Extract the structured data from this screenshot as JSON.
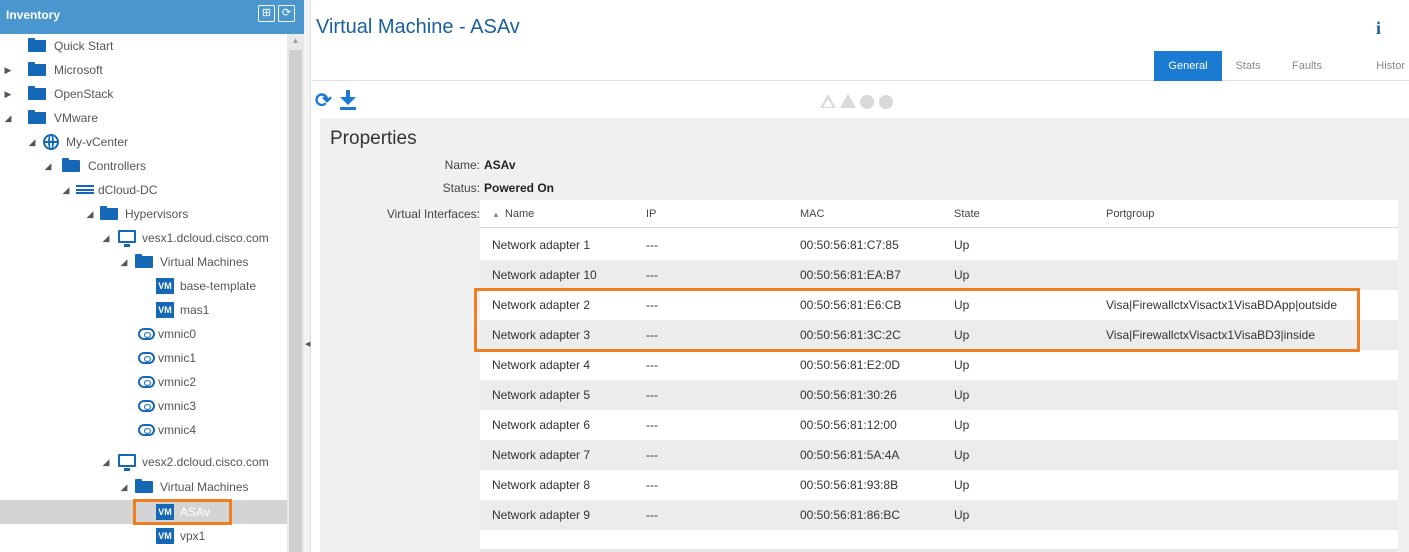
{
  "inventory": {
    "title": "Inventory",
    "tree": [
      {
        "label": "Quick Start",
        "icon": "folder-icon"
      },
      {
        "label": "Microsoft",
        "icon": "folder-icon",
        "expander": "collapsed"
      },
      {
        "label": "OpenStack",
        "icon": "folder-icon",
        "expander": "collapsed"
      },
      {
        "label": "VMware",
        "icon": "folder-icon",
        "expander": "expanded"
      },
      {
        "label": "My-vCenter",
        "icon": "globe-icon",
        "expander": "expanded"
      },
      {
        "label": "Controllers",
        "icon": "folder-icon",
        "expander": "expanded"
      },
      {
        "label": "dCloud-DC",
        "icon": "datacenter-icon",
        "expander": "expanded"
      },
      {
        "label": "Hypervisors",
        "icon": "folder-icon",
        "expander": "expanded"
      },
      {
        "label": "vesx1.dcloud.cisco.com",
        "icon": "host-icon",
        "expander": "expanded"
      },
      {
        "label": "Virtual Machines",
        "icon": "folder-icon",
        "expander": "expanded"
      },
      {
        "label": "base-template",
        "icon": "vm-icon",
        "icon_text": "VM"
      },
      {
        "label": "mas1",
        "icon": "vm-icon",
        "icon_text": "VM"
      },
      {
        "label": "vmnic0",
        "icon": "cloud-icon"
      },
      {
        "label": "vmnic1",
        "icon": "cloud-icon"
      },
      {
        "label": "vmnic2",
        "icon": "cloud-icon"
      },
      {
        "label": "vmnic3",
        "icon": "cloud-icon"
      },
      {
        "label": "vmnic4",
        "icon": "cloud-icon"
      },
      {
        "label": "vesx2.dcloud.cisco.com",
        "icon": "host-icon",
        "expander": "expanded"
      },
      {
        "label": "Virtual Machines",
        "icon": "folder-icon",
        "expander": "expanded"
      },
      {
        "label": "ASAv",
        "icon": "vm-icon",
        "icon_text": "VM",
        "selected": true
      },
      {
        "label": "vpx1",
        "icon": "vm-icon",
        "icon_text": "VM"
      }
    ]
  },
  "main": {
    "title": "Virtual Machine - ASAv",
    "info_glyph": "i",
    "tabs": [
      "General",
      "Stats",
      "Faults",
      "Histor"
    ],
    "active_tab": "General",
    "toolbar": {
      "refresh_glyph": "⟳"
    },
    "section_title": "Properties",
    "properties": {
      "name_label": "Name:",
      "name_value": "ASAv",
      "status_label": "Status:",
      "status_value": "Powered On",
      "interfaces_label": "Virtual Interfaces:"
    },
    "interfaces": {
      "columns": [
        "Name",
        "IP",
        "MAC",
        "State",
        "Portgroup"
      ],
      "sorted_column": "Name",
      "rows": [
        {
          "name": "Network adapter 1",
          "ip": "---",
          "mac": "00:50:56:81:C7:85",
          "state": "Up",
          "portgroup": ""
        },
        {
          "name": "Network adapter 10",
          "ip": "---",
          "mac": "00:50:56:81:EA:B7",
          "state": "Up",
          "portgroup": ""
        },
        {
          "name": "Network adapter 2",
          "ip": "---",
          "mac": "00:50:56:81:E6:CB",
          "state": "Up",
          "portgroup": "Visa|FirewallctxVisactx1VisaBDApp|outside"
        },
        {
          "name": "Network adapter 3",
          "ip": "---",
          "mac": "00:50:56:81:3C:2C",
          "state": "Up",
          "portgroup": "Visa|FirewallctxVisactx1VisaBD3|inside"
        },
        {
          "name": "Network adapter 4",
          "ip": "---",
          "mac": "00:50:56:81:E2:0D",
          "state": "Up",
          "portgroup": ""
        },
        {
          "name": "Network adapter 5",
          "ip": "---",
          "mac": "00:50:56:81:30:26",
          "state": "Up",
          "portgroup": ""
        },
        {
          "name": "Network adapter 6",
          "ip": "---",
          "mac": "00:50:56:81:12:00",
          "state": "Up",
          "portgroup": ""
        },
        {
          "name": "Network adapter 7",
          "ip": "---",
          "mac": "00:50:56:81:5A:4A",
          "state": "Up",
          "portgroup": ""
        },
        {
          "name": "Network adapter 8",
          "ip": "---",
          "mac": "00:50:56:81:93:8B",
          "state": "Up",
          "portgroup": ""
        },
        {
          "name": "Network adapter 9",
          "ip": "---",
          "mac": "00:50:56:81:86:BC",
          "state": "Up",
          "portgroup": ""
        }
      ]
    }
  },
  "colors": {
    "header_blue": "#4a97cf",
    "accent_blue": "#1b7ad1",
    "highlight_orange": "#ef7d22",
    "selected_row": "#d4d4d4"
  }
}
